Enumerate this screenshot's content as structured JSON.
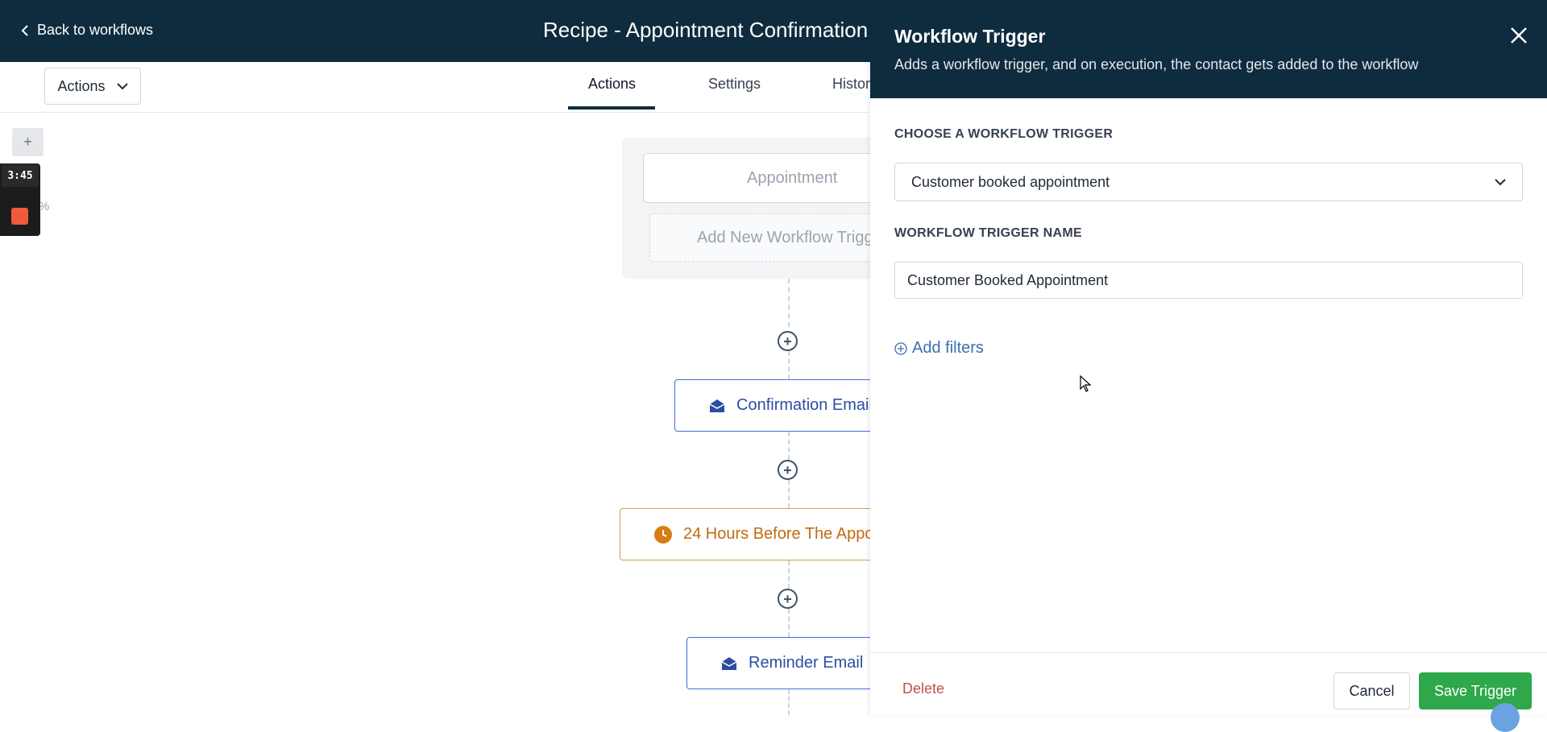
{
  "header": {
    "back_label": "Back to workflows",
    "title": "Recipe - Appointment Confirmation -"
  },
  "toolbar": {
    "actions_dropdown": "Actions",
    "tabs": [
      {
        "label": "Actions",
        "active": true
      },
      {
        "label": "Settings",
        "active": false
      },
      {
        "label": "Histor",
        "active": false
      }
    ]
  },
  "left_tools": {
    "zoom_in": "+",
    "recorder_time": "3:45",
    "zoom_pct": "%"
  },
  "canvas": {
    "trigger_node": "Appointment",
    "add_trigger": "Add New Workflow Trigg",
    "nodes": [
      {
        "label": "Confirmation Email",
        "type": "email"
      },
      {
        "label": "24 Hours Before The Appo",
        "type": "wait"
      },
      {
        "label": "Reminder Email",
        "type": "email"
      }
    ],
    "add_step": "+"
  },
  "panel": {
    "title": "Workflow Trigger",
    "subtitle": "Adds a workflow trigger, and on execution, the contact gets added to the workflow",
    "choose_label": "CHOOSE A WORKFLOW TRIGGER",
    "selected_trigger": "Customer booked appointment",
    "name_label": "WORKFLOW TRIGGER NAME",
    "name_value": "Customer Booked Appointment",
    "add_filters": "Add filters",
    "delete": "Delete",
    "cancel": "Cancel",
    "save": "Save Trigger"
  },
  "colors": {
    "header_bg": "#0f2c3f",
    "save_green": "#2ea84a",
    "email_blue": "#2b4ea2",
    "wait_orange": "#c26b13",
    "delete_red": "#c0504d"
  }
}
